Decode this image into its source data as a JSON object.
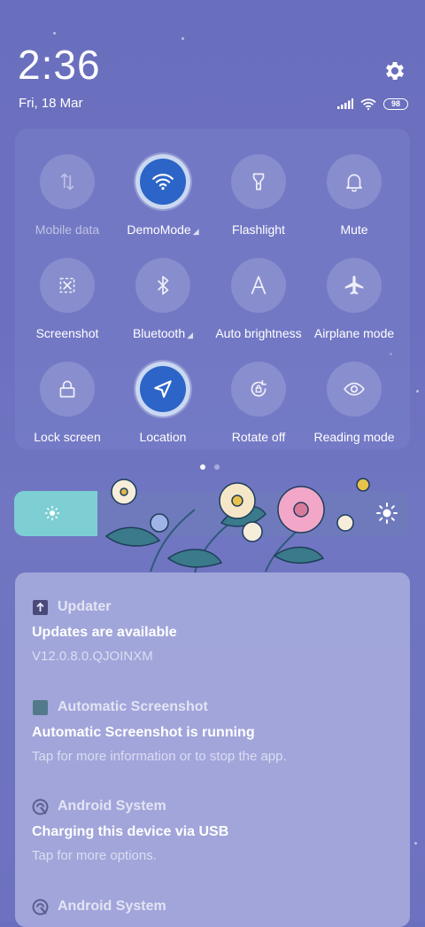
{
  "status_bar": {
    "time": "2:36",
    "date": "Fri, 18 Mar",
    "battery": "98",
    "icons": [
      "signal-icon",
      "wifi-icon",
      "battery-icon"
    ],
    "settings_icon": "gear-icon"
  },
  "quick_settings": {
    "tiles": [
      {
        "label": "Mobile data",
        "icon": "mobile-data-icon",
        "active": false,
        "dimmed": true
      },
      {
        "label": "DemoMode",
        "icon": "wifi-icon",
        "active": true,
        "has_arrow": true
      },
      {
        "label": "Flashlight",
        "icon": "flashlight-icon",
        "active": false
      },
      {
        "label": "Mute",
        "icon": "bell-icon",
        "active": false
      },
      {
        "label": "Screenshot",
        "icon": "screenshot-icon",
        "active": false
      },
      {
        "label": "Bluetooth",
        "icon": "bluetooth-icon",
        "active": false,
        "has_arrow": true
      },
      {
        "label": "Auto brightness",
        "icon": "auto-brightness-icon",
        "active": false
      },
      {
        "label": "Airplane mode",
        "icon": "airplane-icon",
        "active": false
      },
      {
        "label": "Lock screen",
        "icon": "lock-icon",
        "active": false
      },
      {
        "label": "Location",
        "icon": "location-icon",
        "active": true
      },
      {
        "label": "Rotate off",
        "icon": "rotate-lock-icon",
        "active": false
      },
      {
        "label": "Reading mode",
        "icon": "eye-icon",
        "active": false
      }
    ],
    "page_indicator": {
      "current": 1,
      "total": 2
    }
  },
  "brightness": {
    "level": 0.21,
    "fill_color": "#7dcfd3"
  },
  "notifications": [
    {
      "app": "Updater",
      "app_icon": "updater-icon",
      "title": "Updates are available",
      "body": "V12.0.8.0.QJOINXM"
    },
    {
      "app": "Automatic Screenshot",
      "app_icon": "screenshot-app-icon",
      "title": "Automatic Screenshot is running",
      "body": "Tap for more information or to stop the app."
    },
    {
      "app": "Android System",
      "app_icon": "android-icon",
      "title": "Charging this device via USB",
      "body": "Tap for more options."
    },
    {
      "app": "Android System",
      "app_icon": "android-icon",
      "title": "",
      "body": ""
    }
  ]
}
